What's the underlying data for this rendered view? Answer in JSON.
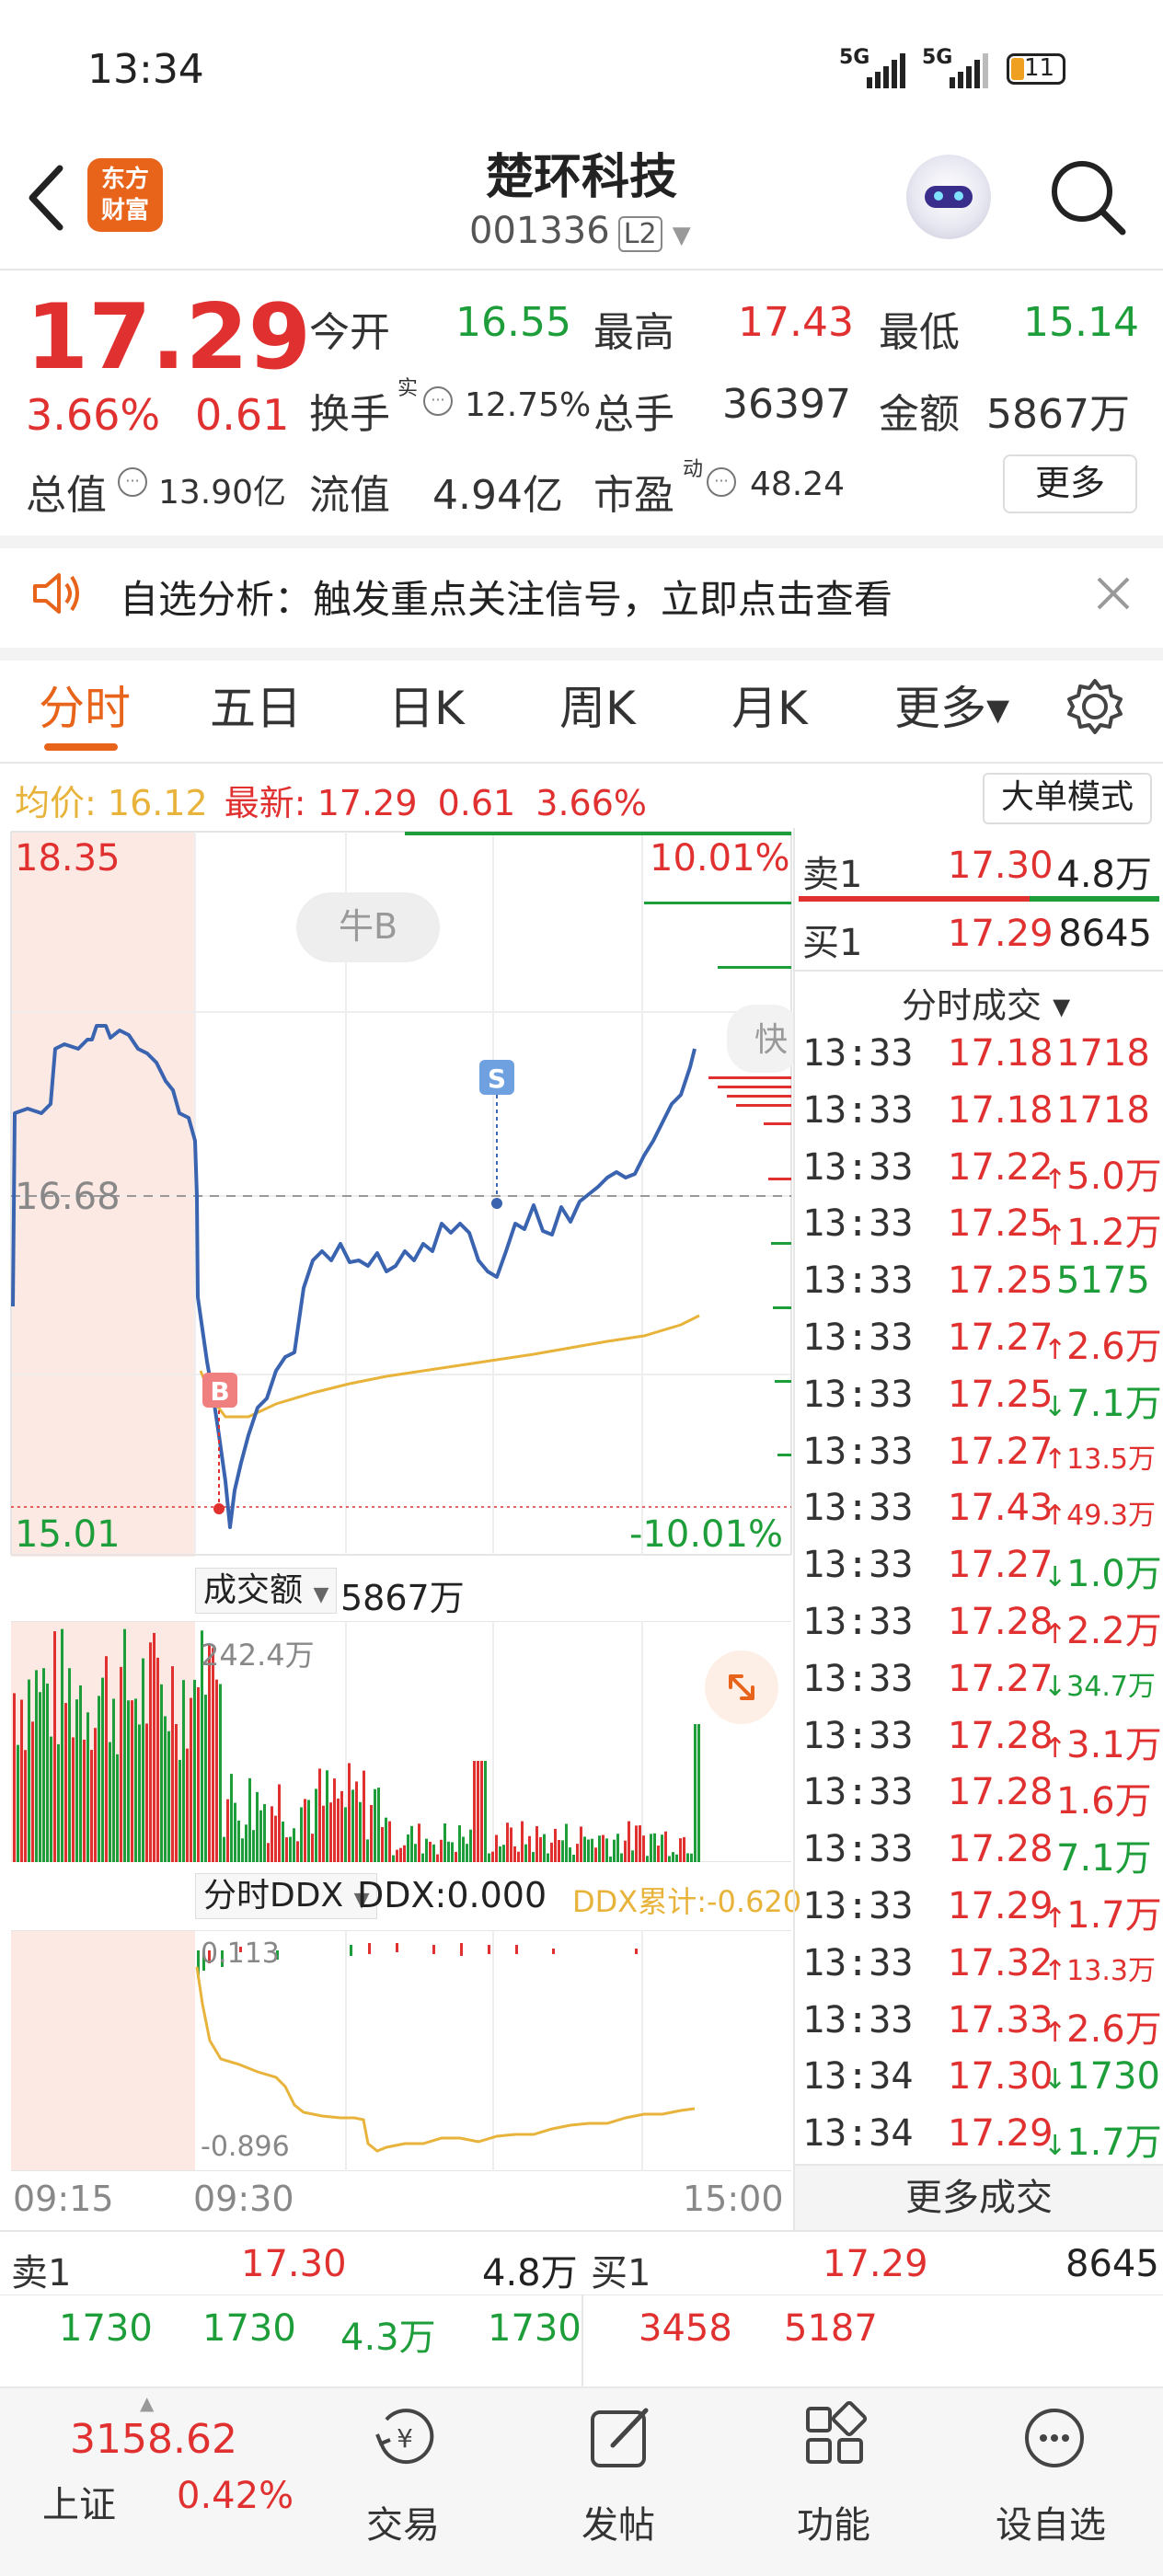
{
  "status_bar": {
    "time": "13:34",
    "signal1": "5G",
    "signal2": "5G",
    "battery": "11"
  },
  "header": {
    "app_logo_line1": "东方",
    "app_logo_line2": "财富",
    "stock_name": "楚环科技",
    "stock_code": "001336",
    "level_badge": "L2"
  },
  "quote": {
    "price": "17.29",
    "change_pct": "3.66%",
    "change": "0.61",
    "open_label": "今开",
    "open": "16.55",
    "high_label": "最高",
    "high": "17.43",
    "low_label": "最低",
    "low": "15.14",
    "turnover_label": "换手",
    "turnover_sup": "实",
    "turnover": "12.75%",
    "volume_label": "总手",
    "volume": "36397",
    "amount_label": "金额",
    "amount": "5867万",
    "mktcap_label": "总值",
    "mktcap": "13.90亿",
    "float_label": "流值",
    "float": "4.94亿",
    "pe_label": "市盈",
    "pe_sup": "动",
    "pe": "48.24",
    "more": "更多"
  },
  "banner": {
    "text": "自选分析：触发重点关注信号，立即点击查看"
  },
  "tabs": [
    "分时",
    "五日",
    "日K",
    "周K",
    "月K",
    "更多▾"
  ],
  "chart_info": {
    "avg_label": "均价:",
    "avg": "16.12",
    "latest_label": "最新:",
    "latest": "17.29",
    "chg": "0.61",
    "pct": "3.66%",
    "mode_button": "大单模式"
  },
  "chart_labels": {
    "top_price": "18.35",
    "top_pct": "10.01%",
    "mid_price": "16.68",
    "bottom_price": "15.01",
    "bottom_pct": "-10.01%",
    "bull_tag": "牛B",
    "buy_marker": "B",
    "sell_marker": "S",
    "side_tag": "快",
    "vol_selector": "成交额",
    "vol_value": "5867万",
    "vol_max": "242.4万",
    "ddx_selector": "分时DDX",
    "ddx_value": "DDX:0.000",
    "ddx_cum": "DDX累计:-0.620",
    "ddx_top": "0.113",
    "ddx_bottom": "-0.896",
    "time_start": "09:15",
    "time_open": "09:30",
    "time_end": "15:00"
  },
  "order_book_side": {
    "sell1_label": "卖1",
    "sell1_price": "17.30",
    "sell1_vol": "4.8万",
    "buy1_label": "买1",
    "buy1_price": "17.29",
    "buy1_vol": "8645"
  },
  "ticks_header": "分时成交 ▾",
  "ticks": [
    {
      "time": "13:33",
      "price": "17.18",
      "arrow": "",
      "vol": "1718",
      "color": "red",
      "small": false
    },
    {
      "time": "13:33",
      "price": "17.18",
      "arrow": "",
      "vol": "1718",
      "color": "red",
      "small": false
    },
    {
      "time": "13:33",
      "price": "17.22",
      "arrow": "↑",
      "vol": "5.0万",
      "color": "red",
      "small": false
    },
    {
      "time": "13:33",
      "price": "17.25",
      "arrow": "↑",
      "vol": "1.2万",
      "color": "red",
      "small": false
    },
    {
      "time": "13:33",
      "price": "17.25",
      "arrow": "",
      "vol": "5175",
      "color": "green",
      "small": false
    },
    {
      "time": "13:33",
      "price": "17.27",
      "arrow": "↑",
      "vol": "2.6万",
      "color": "red",
      "small": false
    },
    {
      "time": "13:33",
      "price": "17.25",
      "arrow": "↓",
      "vol": "7.1万",
      "color": "green",
      "small": false
    },
    {
      "time": "13:33",
      "price": "17.27",
      "arrow": "↑",
      "vol": "13.5万",
      "color": "red",
      "small": true
    },
    {
      "time": "13:33",
      "price": "17.43",
      "arrow": "↑",
      "vol": "49.3万",
      "color": "red",
      "small": true
    },
    {
      "time": "13:33",
      "price": "17.27",
      "arrow": "↓",
      "vol": "1.0万",
      "color": "green",
      "small": false
    },
    {
      "time": "13:33",
      "price": "17.28",
      "arrow": "↑",
      "vol": "2.2万",
      "color": "red",
      "small": false
    },
    {
      "time": "13:33",
      "price": "17.27",
      "arrow": "↓",
      "vol": "34.7万",
      "color": "green",
      "small": true
    },
    {
      "time": "13:33",
      "price": "17.28",
      "arrow": "↑",
      "vol": "3.1万",
      "color": "red",
      "small": false
    },
    {
      "time": "13:33",
      "price": "17.28",
      "arrow": "",
      "vol": "1.6万",
      "color": "red",
      "small": false
    },
    {
      "time": "13:33",
      "price": "17.28",
      "arrow": "",
      "vol": "7.1万",
      "color": "green",
      "small": false
    },
    {
      "time": "13:33",
      "price": "17.29",
      "arrow": "↑",
      "vol": "1.7万",
      "color": "red",
      "small": false
    },
    {
      "time": "13:33",
      "price": "17.32",
      "arrow": "↑",
      "vol": "13.3万",
      "color": "red",
      "small": true
    },
    {
      "time": "13:33",
      "price": "17.33",
      "arrow": "↑",
      "vol": "2.6万",
      "color": "red",
      "small": false
    },
    {
      "time": "13:34",
      "price": "17.30",
      "arrow": "↓",
      "vol": "1730",
      "color": "green",
      "small": false
    },
    {
      "time": "13:34",
      "price": "17.29",
      "arrow": "↓",
      "vol": "1.7万",
      "color": "green",
      "small": false
    }
  ],
  "more_ticks": "更多成交",
  "bottom_book": {
    "sell1_label": "卖1",
    "sell1_price": "17.30",
    "sell1_vol": "4.8万",
    "buy1_label": "买1",
    "buy1_price": "17.29",
    "buy1_vol": "8645",
    "sell_details": [
      "1730",
      "1730",
      "4.3万",
      "1730"
    ],
    "buy_details": [
      "3458",
      "5187"
    ]
  },
  "bottom_nav": {
    "index_value": "3158.62",
    "index_name": "上证",
    "index_pct": "0.42%",
    "items": [
      "交易",
      "发帖",
      "功能",
      "设自选"
    ]
  },
  "colors": {
    "up": "#e03030",
    "down": "#1e9e3a",
    "accent": "#e8641b",
    "price_line": "#3a63b0",
    "avg_line": "#e8b33a"
  }
}
